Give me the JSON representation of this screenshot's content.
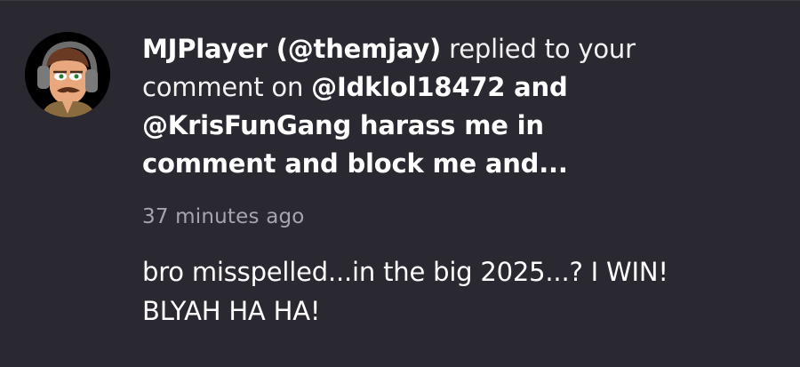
{
  "notification": {
    "actor": "MJPlayer (@themjay)",
    "action_line1": "replied to your",
    "action_line2": "comment on",
    "comment_title_line1": "@Idklol18472 and",
    "comment_title_line2": "@KrisFunGang harass me in",
    "comment_title_line3": "comment and block me and...",
    "timestamp": "37 minutes ago",
    "reply_line1": "bro misspelled...in the big 2025...? I WIN!",
    "reply_line2": "BLYAH HA HA!"
  },
  "avatar": {
    "icon": "cartoon-man-headphones-avatar-icon"
  },
  "colors": {
    "background": "#2a2830",
    "text": "#ffffff",
    "muted": "#a7a4ad",
    "avatar_bg": "#000000"
  }
}
